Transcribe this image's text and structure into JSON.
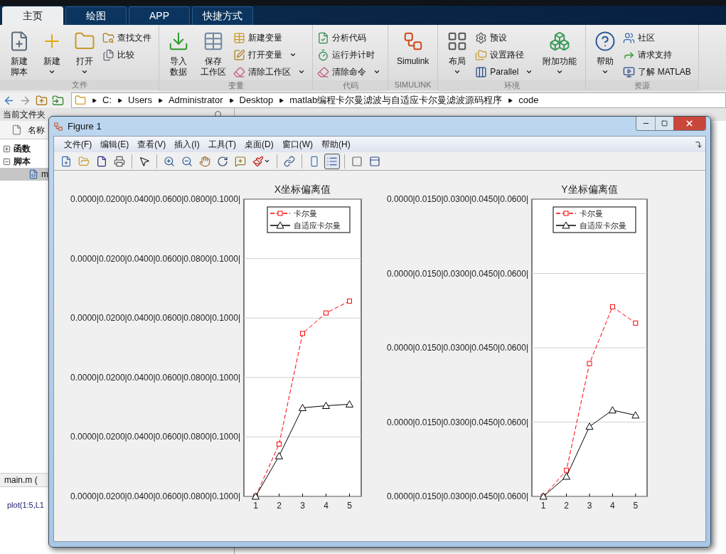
{
  "ribbon": {
    "tabs": [
      {
        "label": "主页",
        "selected": true
      },
      {
        "label": "绘图",
        "selected": false
      },
      {
        "label": "APP",
        "selected": false
      },
      {
        "label": "快捷方式",
        "selected": false
      }
    ],
    "groups": [
      {
        "label": "文件",
        "items": [
          {
            "kind": "large",
            "label": [
              "新建",
              "脚本"
            ],
            "dropdown": false
          },
          {
            "kind": "large",
            "label": "新建",
            "dropdown": true
          },
          {
            "kind": "large",
            "label": "打开",
            "dropdown": true
          },
          {
            "kind": "small",
            "label": "查找文件",
            "dropdown": false
          },
          {
            "kind": "small",
            "label": "比较",
            "dropdown": false
          }
        ]
      },
      {
        "label": "变量",
        "items": [
          {
            "kind": "large",
            "label": [
              "导入",
              "数据"
            ],
            "dropdown": false
          },
          {
            "kind": "large",
            "label": [
              "保存",
              "工作区"
            ],
            "dropdown": false
          },
          {
            "kind": "small",
            "label": "新建变量",
            "dropdown": false
          },
          {
            "kind": "small",
            "label": "打开变量",
            "dropdown": true
          },
          {
            "kind": "small",
            "label": "清除工作区",
            "dropdown": true
          }
        ]
      },
      {
        "label": "代码",
        "items": [
          {
            "kind": "small",
            "label": "分析代码",
            "dropdown": false
          },
          {
            "kind": "small",
            "label": "运行并计时",
            "dropdown": false
          },
          {
            "kind": "small",
            "label": "清除命令",
            "dropdown": true
          }
        ]
      },
      {
        "label": "SIMULINK",
        "items": [
          {
            "kind": "large",
            "label": "Simulink",
            "dropdown": false
          }
        ]
      },
      {
        "label": "环境",
        "items": [
          {
            "kind": "large",
            "label": "布局",
            "dropdown": true
          },
          {
            "kind": "small",
            "label": "预设",
            "dropdown": false
          },
          {
            "kind": "small",
            "label": "设置路径",
            "dropdown": false
          },
          {
            "kind": "small",
            "label": "Parallel",
            "dropdown": true
          },
          {
            "kind": "large",
            "label": "附加功能",
            "dropdown": true
          }
        ]
      },
      {
        "label": "资源",
        "items": [
          {
            "kind": "large",
            "label": "帮助",
            "dropdown": true
          },
          {
            "kind": "small",
            "label": "社区",
            "dropdown": false
          },
          {
            "kind": "small",
            "label": "请求支持",
            "dropdown": false
          },
          {
            "kind": "small",
            "label": "了解 MATLAB",
            "dropdown": false
          }
        ]
      }
    ]
  },
  "address_bar": {
    "path": [
      "C:",
      "Users",
      "Administrator",
      "Desktop",
      "matlab编程卡尔曼滤波与自适应卡尔曼滤波源码程序",
      "code"
    ]
  },
  "file_panel": {
    "title": "当前文件夹",
    "column": "名称",
    "tree": [
      {
        "label": "函数",
        "expanded": false
      },
      {
        "label": "脚本",
        "expanded": true,
        "children": [
          {
            "label": "m",
            "selected": true
          }
        ]
      }
    ],
    "details_title": "main.m (",
    "details_code": "plot(1:5,L1"
  },
  "figure": {
    "title": "Figure 1",
    "menu": [
      "文件(F)",
      "编辑(E)",
      "查看(V)",
      "插入(I)",
      "工具(T)",
      "桌面(D)",
      "窗口(W)",
      "帮助(H)"
    ],
    "toolbar": [
      {
        "pressed": false
      },
      {
        "pressed": false
      },
      {
        "pressed": false
      },
      {
        "pressed": false
      },
      {
        "pressed": false
      },
      {
        "pressed": false
      },
      {
        "pressed": false
      },
      {
        "pressed": false
      },
      {
        "pressed": false
      },
      {
        "pressed": false
      },
      {
        "pressed": false
      },
      {
        "pressed": false
      },
      {
        "pressed": false
      },
      {
        "pressed": true
      },
      {
        "pressed": false
      },
      {
        "pressed": false
      }
    ],
    "plots": [
      {
        "title": "X坐标偏离值",
        "y_tick_labels": [
          "0.0000|0.0200|0.0400|0.0600|0.0800|0.1000|",
          "0.0000|0.0200|0.0400|0.0600|0.0800|0.1000|",
          "0.0000|0.0200|0.0400|0.0600|0.0800|0.1000|",
          "0.0000|0.0200|0.0400|0.0600|0.0800|0.1000|",
          "0.0000|0.0200|0.0400|0.0600|0.0800|0.1000|",
          "0.0000|0.0200|0.0400|0.0600|0.0800|0.1000|"
        ],
        "x_tick_labels": [
          "1",
          "2",
          "3",
          "4",
          "5"
        ],
        "legend": [
          {
            "name": "卡尔曼",
            "color": "#ff0000",
            "kind": "dashed"
          },
          {
            "name": "自适应卡尔曼",
            "color": "#000000",
            "kind": "solid"
          }
        ]
      },
      {
        "title": "Y坐标偏离值",
        "y_tick_labels": [
          "0.0000|0.0150|0.0300|0.0450|0.0600|",
          "0.0000|0.0150|0.0300|0.0450|0.0600|",
          "0.0000|0.0150|0.0300|0.0450|0.0600|",
          "0.0000|0.0150|0.0300|0.0450|0.0600|",
          "0.0000|0.0150|0.0300|0.0450|0.0600|"
        ],
        "x_tick_labels": [
          "1",
          "2",
          "3",
          "4",
          "5"
        ],
        "legend": [
          {
            "name": "卡尔曼",
            "color": "#ff0000",
            "kind": "dashed"
          },
          {
            "name": "自适应卡尔曼",
            "color": "#000000",
            "kind": "solid"
          }
        ]
      }
    ]
  }
}
